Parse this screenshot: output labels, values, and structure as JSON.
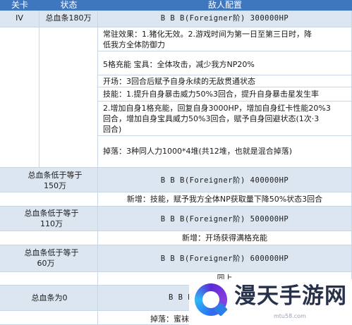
{
  "header": {
    "col_level": "关卡",
    "col_status": "状态",
    "col_config": "敌人配置"
  },
  "rows": {
    "r1": {
      "level": "IV",
      "status": "总血条180万",
      "config": "B B B(Foreigner阶) 300000HP"
    },
    "r2": {
      "line1": "常驻效果：1.猪化无效。2.游戏时间为第一日至第三日时，降",
      "line2": "低我方全体防御力"
    },
    "r3": {
      "text": "5格充能  宝具：全体攻击，减少我方NP20%"
    },
    "r4": {
      "text": "开场：3回合后赋予自身永续的无敌贯通状态"
    },
    "r5": {
      "text": "技能：1.提升自身暴击威力50%3回合，提升自身暴击星发生率"
    },
    "r6": {
      "line1": "2.增加自身1格充能，回复自身3000HP，增加自身红卡性能20%3",
      "line2": "回合，增加自身宝具威力50%3回合，赋予自身回避状态(1次·3",
      "line3": "回合)"
    },
    "r7": {
      "text": "掉落：3种同人力1000*4堆(共12堆，也就是混合掉落)"
    },
    "r8": {
      "status_l1": "总血条低于等于",
      "status_l2": "150万",
      "config": "B B B(Foreigner阶) 400000HP"
    },
    "r9": {
      "text": "新增：技能，赋予我方全体NP获取量下降50%状态3回合"
    },
    "r10": {
      "status_l1": "总血条低于等于",
      "status_l2": "110万",
      "config": "B B B(Foreigner阶) 500000HP"
    },
    "r11": {
      "text": "新增：开场获得满格充能"
    },
    "r12": {
      "status_l1": "总血条低于等于",
      "status_l2": "60万",
      "config": "B B B(Foreigner阶) 600000HP"
    },
    "r13": {
      "text": "同上"
    },
    "r14": {
      "status": "总血条为0",
      "config": "B B B"
    },
    "r15": {
      "text": "掉落：蜜袜"
    }
  },
  "watermark": {
    "name": "漫天手游网",
    "url": "mtu58.com"
  }
}
